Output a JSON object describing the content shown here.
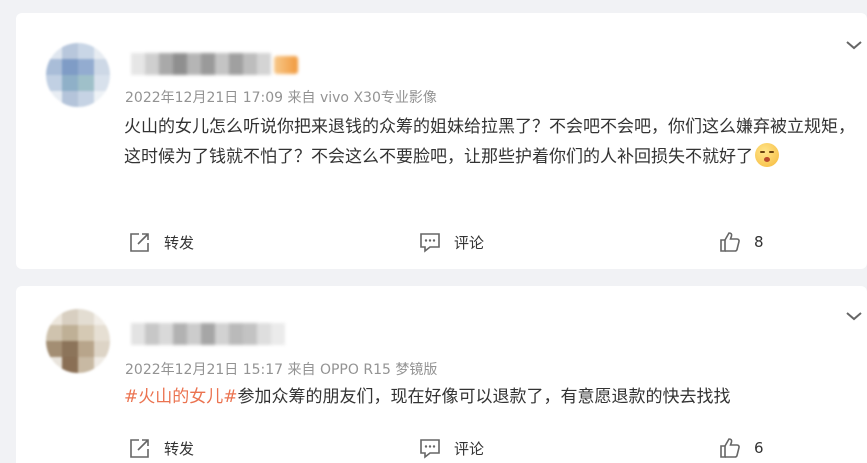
{
  "comments": [
    {
      "timestamp": "2022年12月21日 17:09",
      "source": "来自 vivo X30专业影像",
      "text": "火山的女儿怎么听说你把来退钱的众筹的姐妹给拉黑了？不会吧不会吧，你们这么嫌弃被立规矩，这时候为了钱就不怕了？不会这么不要脸吧，让那些护着你们的人补回损失不就好了",
      "emoji": "shy-face-emoji",
      "actions": {
        "repost": "转发",
        "comment": "评论",
        "like_count": "8"
      }
    },
    {
      "timestamp": "2022年12月21日 15:17",
      "source": "来自 OPPO R15 梦镜版",
      "topic": "#火山的女儿#",
      "text": "参加众筹的朋友们，现在好像可以退款了，有意愿退款的快去找找",
      "actions": {
        "repost": "转发",
        "comment": "评论",
        "like_count": "6"
      }
    }
  ],
  "icons": {
    "more": "chevron-down-icon",
    "repost": "repost-icon",
    "comment": "comment-icon",
    "like": "thumbs-up-icon"
  },
  "colors": {
    "topic": "#eb7350",
    "meta": "#939393",
    "background": "#f1f2f5"
  }
}
